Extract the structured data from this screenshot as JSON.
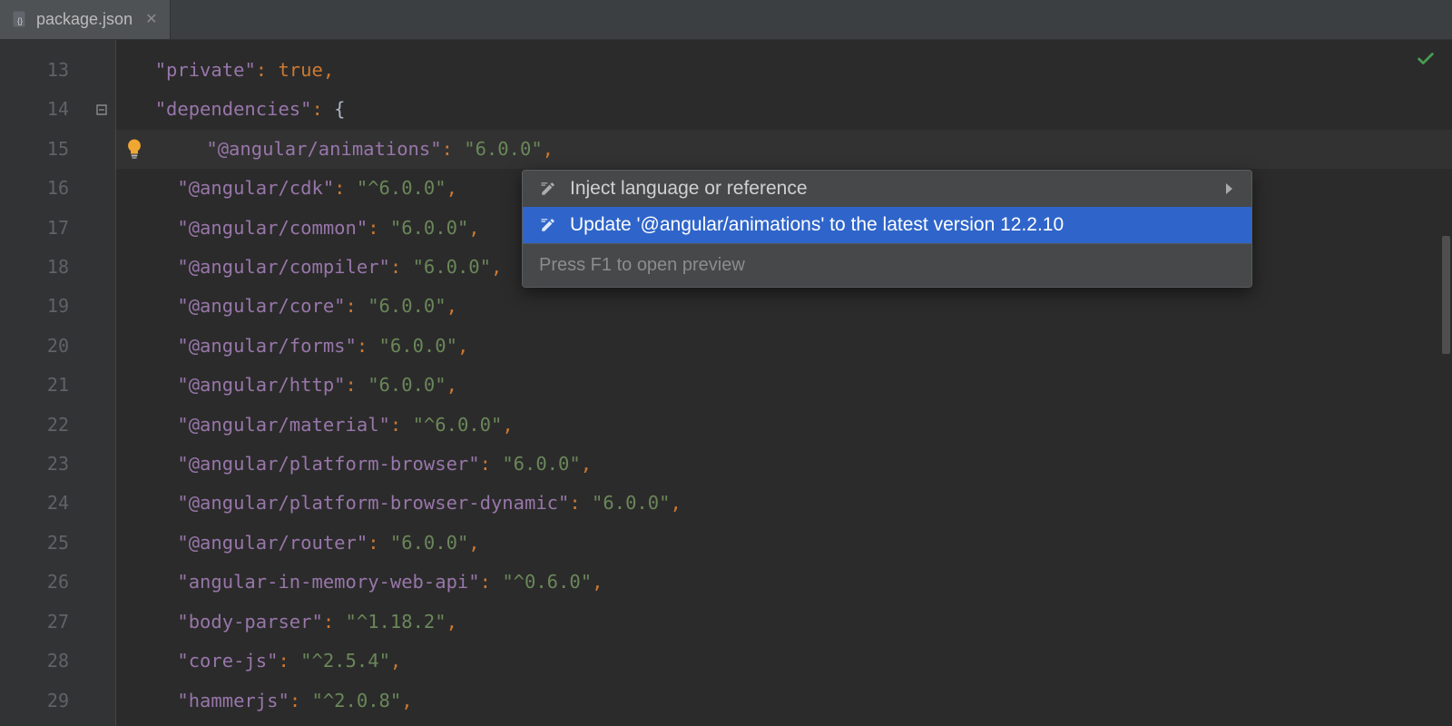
{
  "tab": {
    "filename": "package.json"
  },
  "gutter_start": 13,
  "lines": [
    {
      "indent": 1,
      "key": "private",
      "value_kw": "true",
      "trailing_comma": true
    },
    {
      "indent": 1,
      "key": "dependencies",
      "open_brace": true
    },
    {
      "indent": 2,
      "key": "@angular/animations",
      "value": "6.0.0",
      "trailing_comma": true,
      "highlight": true,
      "bulb": true
    },
    {
      "indent": 2,
      "key": "@angular/cdk",
      "value": "^6.0.0",
      "trailing_comma": true
    },
    {
      "indent": 2,
      "key": "@angular/common",
      "value": "6.0.0",
      "trailing_comma": true
    },
    {
      "indent": 2,
      "key": "@angular/compiler",
      "value": "6.0.0",
      "trailing_comma": true
    },
    {
      "indent": 2,
      "key": "@angular/core",
      "value": "6.0.0",
      "trailing_comma": true
    },
    {
      "indent": 2,
      "key": "@angular/forms",
      "value": "6.0.0",
      "trailing_comma": true
    },
    {
      "indent": 2,
      "key": "@angular/http",
      "value": "6.0.0",
      "trailing_comma": true
    },
    {
      "indent": 2,
      "key": "@angular/material",
      "value": "^6.0.0",
      "trailing_comma": true
    },
    {
      "indent": 2,
      "key": "@angular/platform-browser",
      "value": "6.0.0",
      "trailing_comma": true
    },
    {
      "indent": 2,
      "key": "@angular/platform-browser-dynamic",
      "value": "6.0.0",
      "trailing_comma": true
    },
    {
      "indent": 2,
      "key": "@angular/router",
      "value": "6.0.0",
      "trailing_comma": true
    },
    {
      "indent": 2,
      "key": "angular-in-memory-web-api",
      "value": "^0.6.0",
      "trailing_comma": true
    },
    {
      "indent": 2,
      "key": "body-parser",
      "value": "^1.18.2",
      "trailing_comma": true
    },
    {
      "indent": 2,
      "key": "core-js",
      "value": "^2.5.4",
      "trailing_comma": true
    },
    {
      "indent": 2,
      "key": "hammerjs",
      "value": "^2.0.8",
      "trailing_comma": true
    }
  ],
  "fold_marker_line": 14,
  "popup": {
    "items": [
      {
        "label": "Inject language or reference",
        "submenu": true,
        "selected": false
      },
      {
        "label": "Update '@angular/animations' to the latest version 12.2.10",
        "submenu": false,
        "selected": true
      }
    ],
    "hint": "Press F1 to open preview"
  }
}
